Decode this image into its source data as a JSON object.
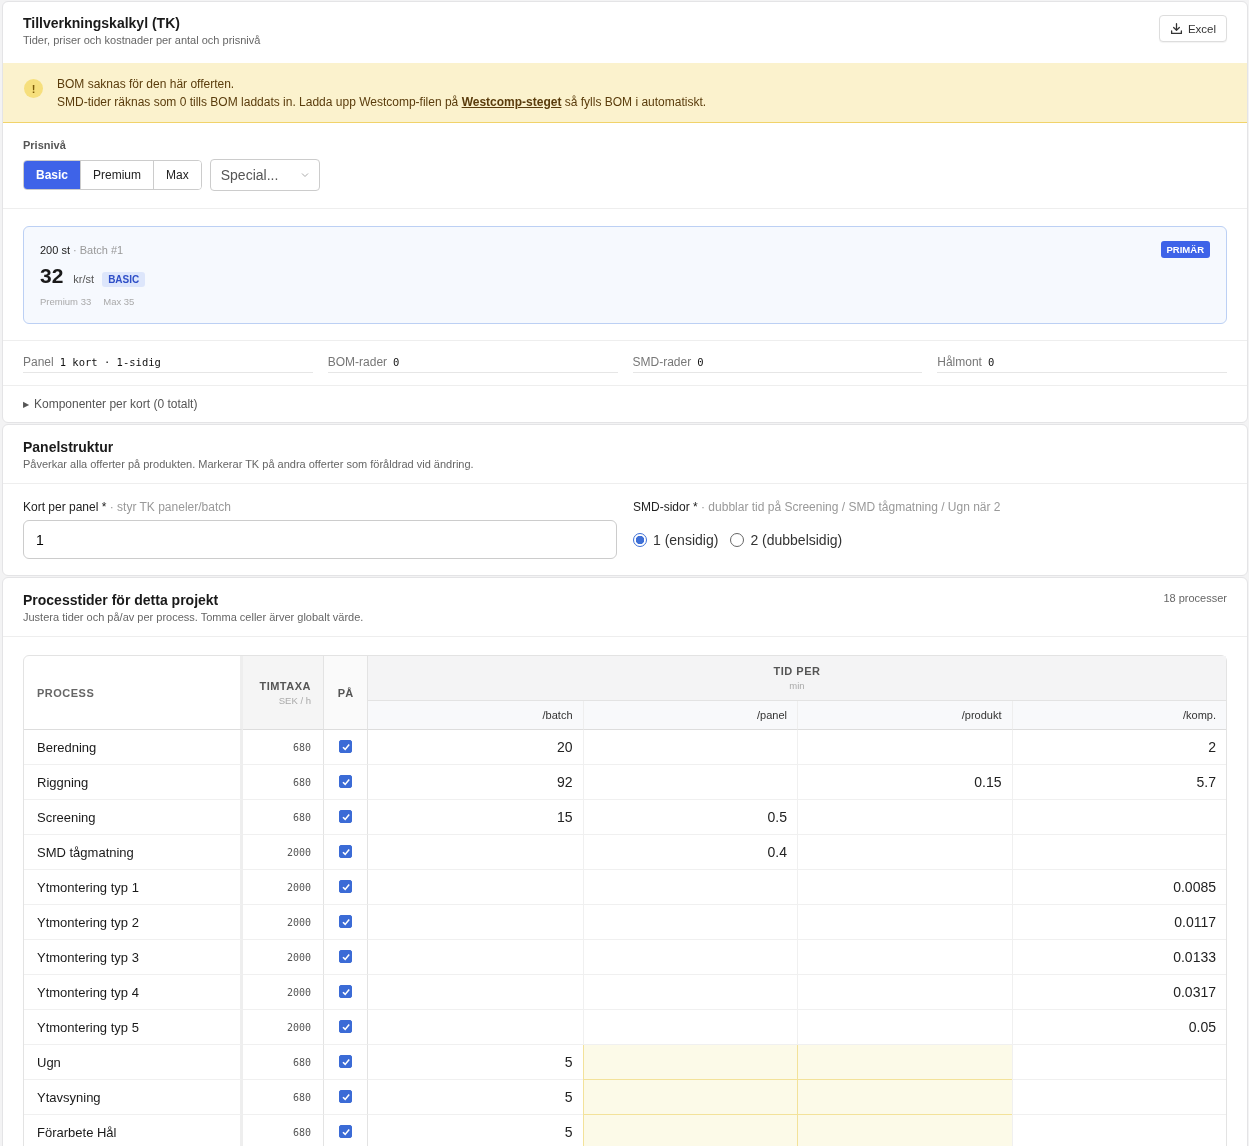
{
  "header": {
    "title": "Tillverkningskalkyl (TK)",
    "subtitle": "Tider, priser och kostnader per antal och prisnivå",
    "export_button": "Excel"
  },
  "alert": {
    "icon": "!",
    "title": "BOM saknas för den här offerten.",
    "message_before": "SMD-tider räknas som 0 tills BOM laddats in. Ladda upp Westcomp-filen på",
    "link": "Westcomp-steget",
    "message_after": "så fylls BOM i automatiskt."
  },
  "price_level": {
    "label": "Prisnivå",
    "options": [
      {
        "label": "Basic",
        "selected": true
      },
      {
        "label": "Premium",
        "selected": false
      },
      {
        "label": "Max",
        "selected": false
      }
    ],
    "special_select": {
      "placeholder": "Special..."
    }
  },
  "batch_card": {
    "quantity": "200 st",
    "batch": "· Batch #1",
    "badge": "PRIMÄR",
    "price": "32",
    "unit": "kr/st",
    "tier": "BASIC",
    "alternatives": [
      "Premium 33",
      "Max 35"
    ]
  },
  "stats": [
    {
      "label": "Panel",
      "value": "1 kort · 1-sidig"
    },
    {
      "label": "BOM-rader",
      "value": "0"
    },
    {
      "label": "SMD-rader",
      "value": "0"
    },
    {
      "label": "Hålmont",
      "value": "0"
    }
  ],
  "components_toggle": {
    "icon": "▶",
    "label": "Komponenter per kort (0 totalt)",
    "expanded": false
  },
  "panel_structure": {
    "title": "Panelstruktur",
    "subtitle": "Påverkar alla offerter på produkten. Markerar TK på andra offerter som föråldrad vid ändring.",
    "cards_per_panel": {
      "label": "Kort per panel *",
      "hint": "· styr TK paneler/batch",
      "value": "1"
    },
    "smd_sides": {
      "label": "SMD-sidor *",
      "hint": "· dubblar tid på Screening / SMD tågmatning / Ugn när 2",
      "options": [
        {
          "label": "1 (ensidig)",
          "selected": true
        },
        {
          "label": "2 (dubbelsidig)",
          "selected": false
        }
      ]
    }
  },
  "process_times": {
    "title": "Processtider för detta projekt",
    "subtitle": "Justera tider och på/av per process. Tomma celler ärver globalt värde.",
    "count": "18 processer",
    "table": {
      "columns": {
        "process": "PROCESS",
        "rate": "TIMTAXA",
        "rate_unit": "SEK / h",
        "enabled": "PÅ",
        "time_group": "TID PER",
        "time_unit": "min",
        "time_columns": [
          "/batch",
          "/panel",
          "/produkt",
          "/komp."
        ]
      },
      "rows": [
        {
          "process": "Beredning",
          "rate": "680",
          "checked": true,
          "flagged": false,
          "times": {
            "batch": "20",
            "komp": "2"
          }
        },
        {
          "process": "Riggning",
          "rate": "680",
          "checked": true,
          "flagged": false,
          "times": {
            "batch": "92",
            "produkt": "0.15",
            "komp": "5.7"
          }
        },
        {
          "process": "Screening",
          "rate": "680",
          "checked": true,
          "flagged": false,
          "times": {
            "batch": "15",
            "panel": "0.5"
          }
        },
        {
          "process": "SMD tågmatning",
          "rate": "2000",
          "checked": true,
          "flagged": false,
          "times": {
            "panel": "0.4"
          }
        },
        {
          "process": "Ytmontering typ 1",
          "rate": "2000",
          "checked": true,
          "flagged": false,
          "times": {
            "komp": "0.0085"
          }
        },
        {
          "process": "Ytmontering typ 2",
          "rate": "2000",
          "checked": true,
          "flagged": false,
          "times": {
            "komp": "0.0117"
          }
        },
        {
          "process": "Ytmontering typ 3",
          "rate": "2000",
          "checked": true,
          "flagged": false,
          "times": {
            "komp": "0.0133"
          }
        },
        {
          "process": "Ytmontering typ 4",
          "rate": "2000",
          "checked": true,
          "flagged": false,
          "times": {
            "komp": "0.0317"
          }
        },
        {
          "process": "Ytmontering typ 5",
          "rate": "2000",
          "checked": true,
          "flagged": false,
          "times": {
            "komp": "0.05"
          }
        },
        {
          "process": "Ugn",
          "rate": "680",
          "checked": true,
          "flagged": true,
          "times": {
            "batch": "5"
          }
        },
        {
          "process": "Ytavsyning",
          "rate": "680",
          "checked": true,
          "flagged": true,
          "times": {
            "batch": "5"
          }
        },
        {
          "process": "Förarbete Hål",
          "rate": "680",
          "checked": true,
          "flagged": true,
          "times": {
            "batch": "5"
          }
        }
      ]
    }
  }
}
